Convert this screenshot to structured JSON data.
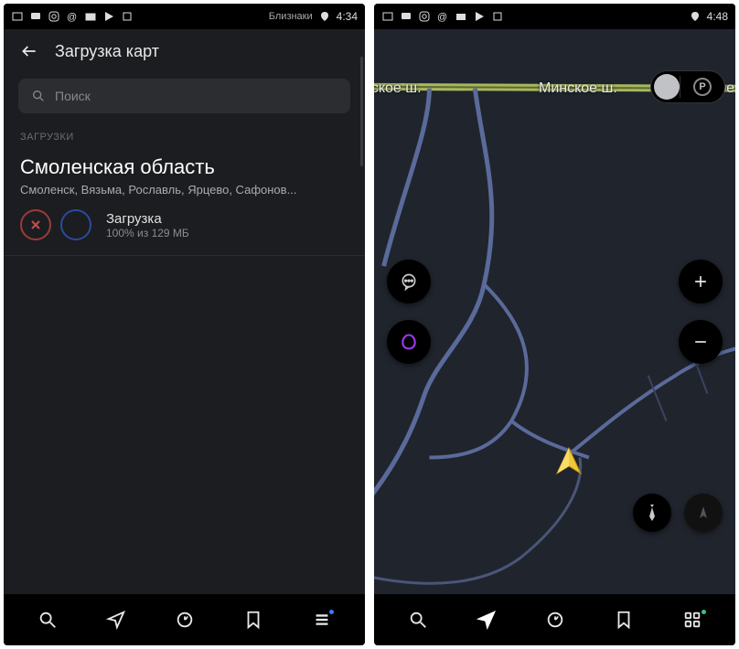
{
  "left": {
    "status": {
      "location_label": "Близнаки",
      "time": "4:34"
    },
    "header": {
      "title": "Загрузка карт"
    },
    "search": {
      "placeholder": "Поиск"
    },
    "section_label": "ЗАГРУЗКИ",
    "download": {
      "title": "Смоленская область",
      "subtitle": "Смоленск, Вязьма, Рославль, Ярцево, Сафонов...",
      "status_label": "Загрузка",
      "status_detail": "100% из 129 МБ"
    }
  },
  "right": {
    "status": {
      "time": "4:48"
    },
    "road_labels": {
      "left_frag": "нское ш.",
      "center": "Минское ш.",
      "right": "Минское ш."
    },
    "parking": "P"
  }
}
